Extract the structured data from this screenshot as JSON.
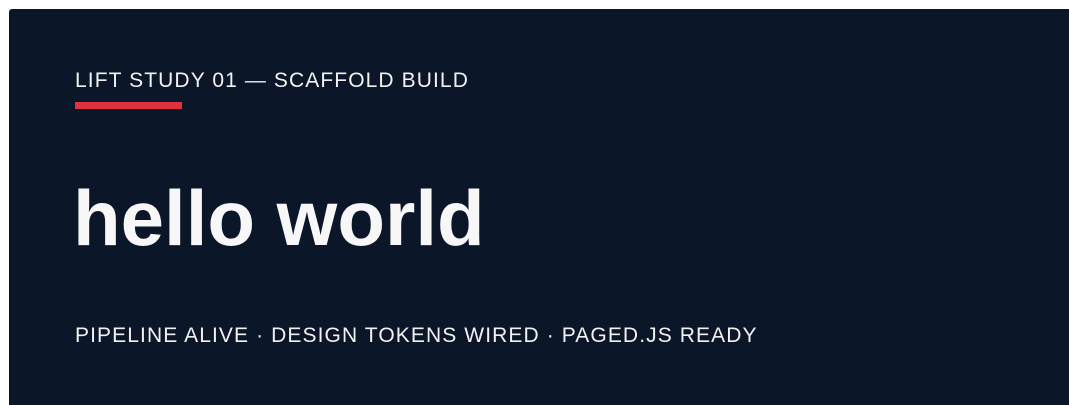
{
  "hero": {
    "eyebrow": "LIFT STUDY 01 — SCAFFOLD BUILD",
    "title": "hello world",
    "status": "PIPELINE ALIVE · DESIGN TOKENS WIRED · PAGED.JS READY"
  },
  "colors": {
    "background": "#0b1628",
    "accent": "#e0323e",
    "text": "#f2f2f2"
  }
}
